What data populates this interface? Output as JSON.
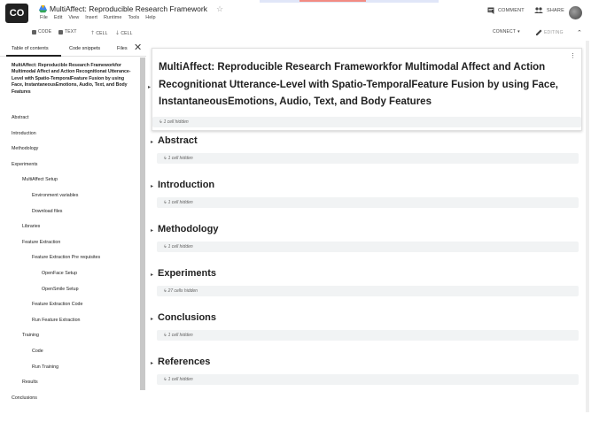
{
  "app": {
    "logo": "CO",
    "doc_title": "MultiAffect: Reproducible Research Framework",
    "menus": [
      "File",
      "Edit",
      "View",
      "Insert",
      "Runtime",
      "Tools",
      "Help"
    ],
    "comment": "COMMENT",
    "share": "SHARE"
  },
  "toolbar": {
    "code": "CODE",
    "text": "TEXT",
    "cell_up": "CELL",
    "cell_down": "CELL",
    "connect": "CONNECT",
    "editing": "EDITING"
  },
  "sidebar": {
    "tabs": [
      "Table of contents",
      "Code snippets",
      "Files"
    ],
    "toc_title": "MultiAffect: Reproducible Research Frameworkfor Multimodal Affect and Action Recognitionat Utterance-Level with Spatio-TemporalFeature Fusion by using Face, InstantaneousEmotions, Audio, Text, and Body Features",
    "items": [
      {
        "label": "Abstract",
        "level": 0
      },
      {
        "label": "Introduction",
        "level": 0
      },
      {
        "label": "Methodology",
        "level": 0
      },
      {
        "label": "Experiments",
        "level": 0
      },
      {
        "label": "MultiAffect Setup",
        "level": 1
      },
      {
        "label": "Environment variables",
        "level": 2
      },
      {
        "label": "Download files",
        "level": 2
      },
      {
        "label": "Libraries",
        "level": 1
      },
      {
        "label": "Feature Extraction",
        "level": 1
      },
      {
        "label": "Feature Extraction Pre requisites",
        "level": 2
      },
      {
        "label": "OpenFace Setup",
        "level": 3
      },
      {
        "label": "OpenSmile Setup",
        "level": 3
      },
      {
        "label": "Feature Extraction Code",
        "level": 2
      },
      {
        "label": "Run Feature Extraction",
        "level": 2
      },
      {
        "label": "Training",
        "level": 1
      },
      {
        "label": "Code",
        "level": 2
      },
      {
        "label": "Run Training",
        "level": 2
      },
      {
        "label": "Results",
        "level": 1
      },
      {
        "label": "Conclusions",
        "level": 0
      }
    ]
  },
  "main": {
    "title": "MultiAffect: Reproducible Research Frameworkfor Multimodal Affect and Action Recognitionat Utterance-Level with Spatio-TemporalFeature Fusion by using Face, InstantaneousEmotions, Audio, Text, and Body Features",
    "title_hidden": "↳ 1 cell hidden",
    "sections": [
      {
        "heading": "Abstract",
        "hidden": "↳ 1 cell hidden"
      },
      {
        "heading": "Introduction",
        "hidden": "↳ 1 cell hidden"
      },
      {
        "heading": "Methodology",
        "hidden": "↳ 1 cell hidden"
      },
      {
        "heading": "Experiments",
        "hidden": "↳ 27 cells hidden"
      },
      {
        "heading": "Conclusions",
        "hidden": "↳ 1 cell hidden"
      },
      {
        "heading": "References",
        "hidden": "↳ 1 cell hidden"
      }
    ]
  }
}
